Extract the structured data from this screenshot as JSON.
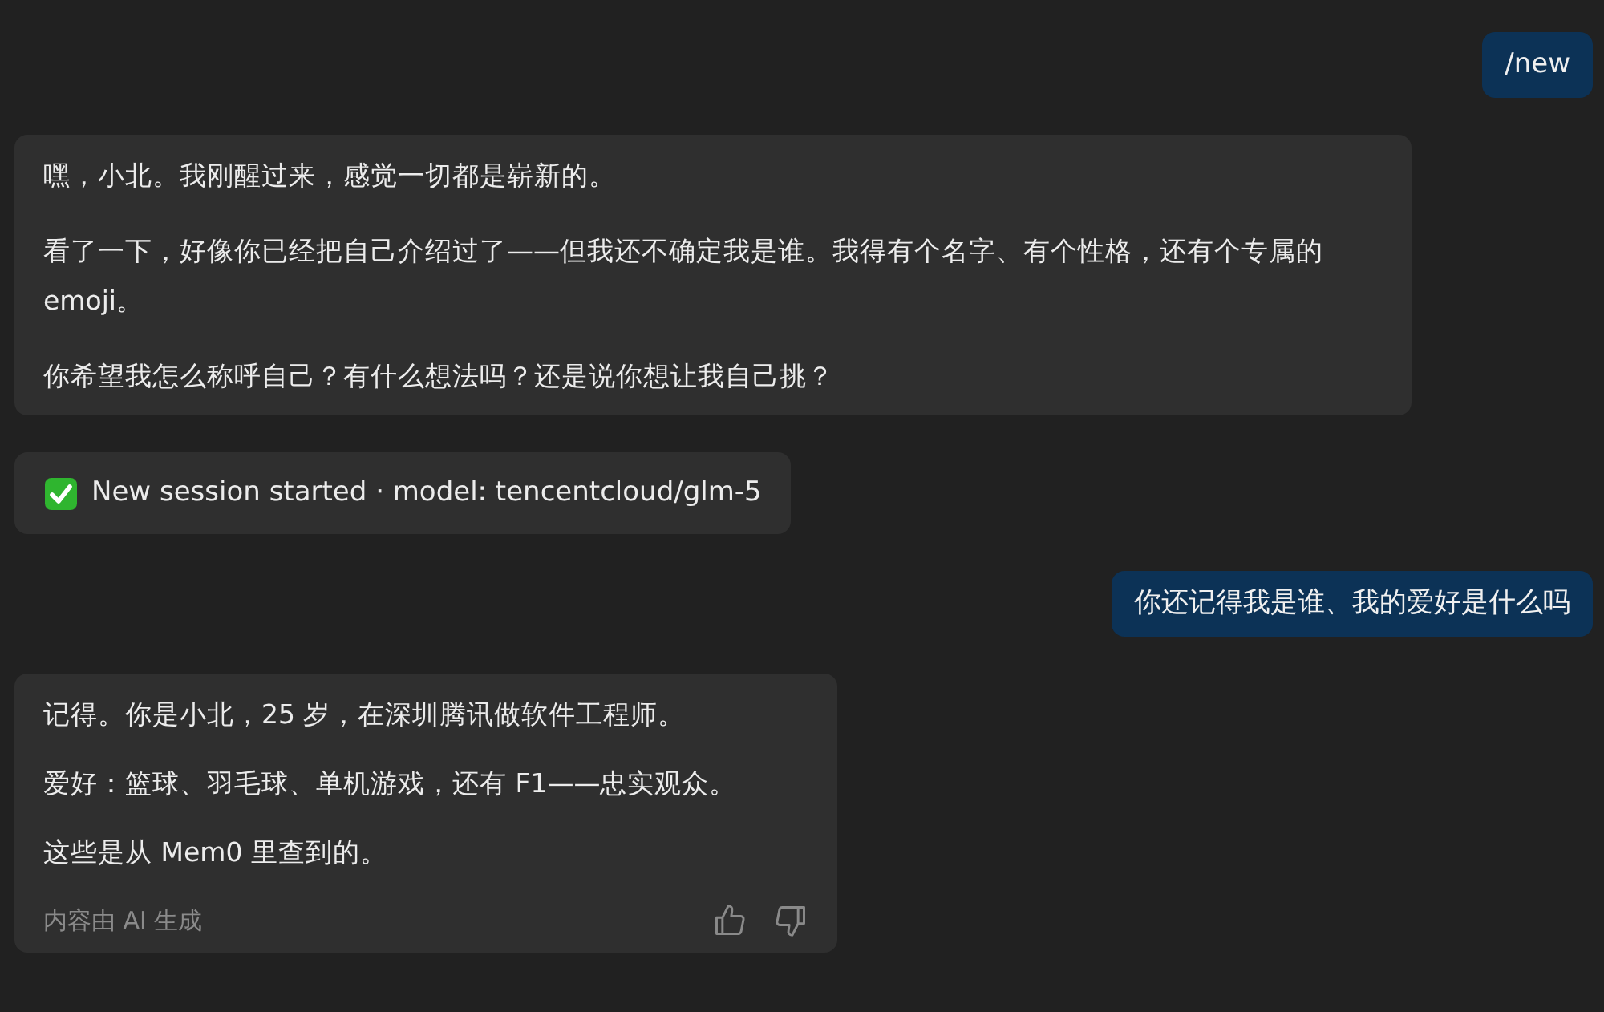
{
  "messages": [
    {
      "kind": "user",
      "text": "/new"
    },
    {
      "kind": "bot",
      "paragraphs": [
        "嘿，小北。我刚醒过来，感觉一切都是崭新的。",
        "看了一下，好像你已经把自己介绍过了——但我还不确定我是谁。我得有个名字、有个性格，还有个专属的 emoji。",
        "你希望我怎么称呼自己？有什么想法吗？还是说你想让我自己挑？"
      ]
    },
    {
      "kind": "system",
      "text": "New session started · model: tencentcloud/glm-5"
    },
    {
      "kind": "user",
      "text": "你还记得我是谁、我的爱好是什么吗"
    },
    {
      "kind": "bot",
      "paragraphs": [
        "记得。你是小北，25 岁，在深圳腾讯做软件工程师。",
        "爱好：篮球、羽毛球、单机游戏，还有 F1——忠实观众。",
        "这些是从 Mem0 里查到的。"
      ],
      "footer": "内容由 AI 生成"
    }
  ]
}
